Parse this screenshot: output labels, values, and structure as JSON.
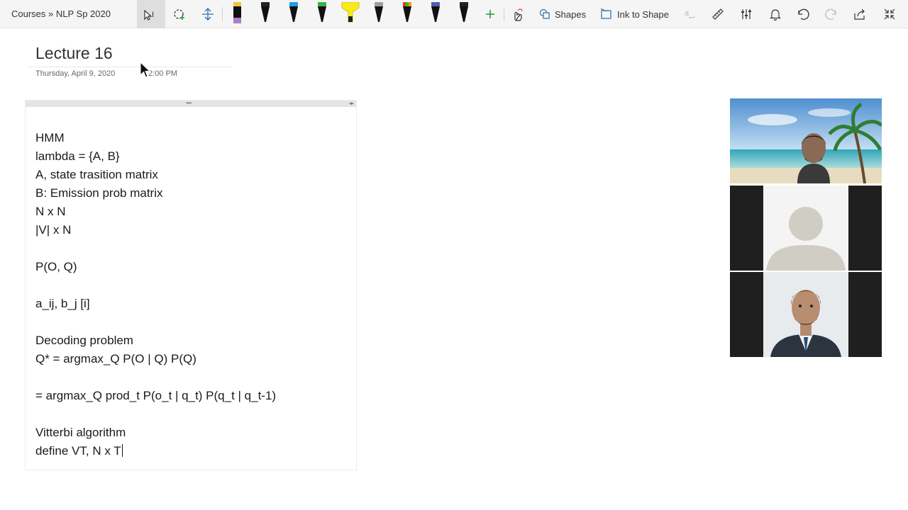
{
  "toolbar": {
    "breadcrumb": "Courses » NLP Sp 2020",
    "shapes_label": "Shapes",
    "ink_to_shape_label": "Ink to Shape"
  },
  "page": {
    "title": "Lecture 16",
    "date": "Thursday, April 9, 2020",
    "time": "2:00 PM"
  },
  "note": {
    "lines": [
      "HMM",
      "lambda = {A, B}",
      "A, state trasition matrix",
      "B: Emission prob matrix",
      "N x N",
      "|V| x N",
      "",
      "P(O, Q)",
      "",
      "a_ij, b_j [i]",
      "",
      "Decoding problem",
      "Q* = argmax_Q P(O | Q) P(Q)",
      "",
      "= argmax_Q prod_t P(o_t | q_t) P(q_t | q_t-1)",
      "",
      "Vitterbi algorithm",
      "define VT, N x T"
    ]
  },
  "colors": {
    "toolbar_bg": "#f5f5f5",
    "accent": "#0f6cbd"
  }
}
